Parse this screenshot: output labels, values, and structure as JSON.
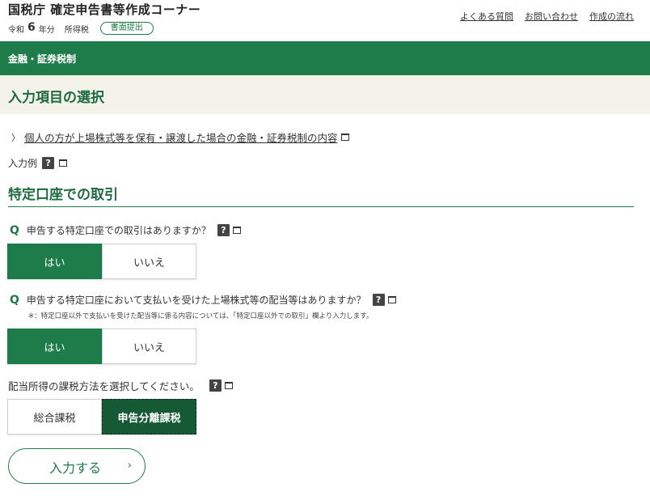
{
  "header": {
    "brand": "国税庁 確定申告書等作成コーナー",
    "era": "令和",
    "year": "6",
    "year_suffix": "年分",
    "tax_type": "所得税",
    "filing_mode": "書面提出",
    "links": [
      "よくある質問",
      "お問い合わせ",
      "作成の流れ"
    ]
  },
  "greenbar": {
    "label": "金融・証券税制"
  },
  "section": {
    "title": "入力項目の選択"
  },
  "info_link": {
    "text": "個人の方が上場株式等を保有・譲渡した場合の金融・証券税制の内容"
  },
  "example": {
    "label": "入力例",
    "help": "?"
  },
  "subsection": {
    "title": "特定口座での取引"
  },
  "q1": {
    "mark": "Q",
    "text": "申告する特定口座での取引はありますか？",
    "help": "?",
    "options": [
      "はい",
      "いいえ"
    ],
    "selected": "はい"
  },
  "q2": {
    "mark": "Q",
    "text": "申告する特定口座において支払いを受けた上場株式等の配当等はありますか？",
    "help": "?",
    "note": "※：特定口座以外で支払いを受けた配当等に係る内容については、「特定口座以外での取引」欄より入力します。",
    "options": [
      "はい",
      "いいえ"
    ],
    "selected": "はい"
  },
  "q3": {
    "text": "配当所得の課税方法を選択してください。",
    "help": "?",
    "options": [
      "総合課税",
      "申告分離課税"
    ],
    "selected": "申告分離課税"
  },
  "submit": {
    "label": "入力する",
    "arrow": "›"
  },
  "colors": {
    "brand_green": "#1e7b4a",
    "section_bg": "#f3f3ea",
    "selected_dark": "#165a35"
  }
}
